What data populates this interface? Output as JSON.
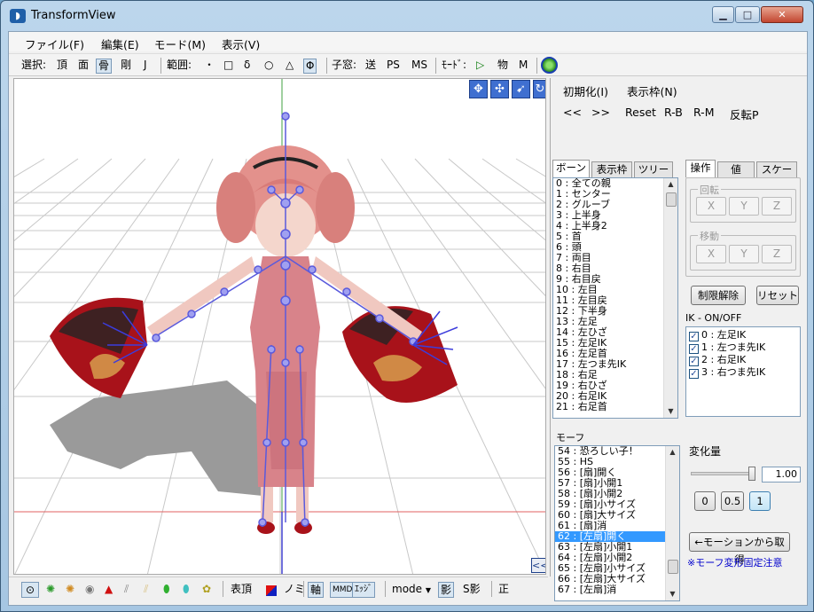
{
  "window": {
    "title": "TransformView",
    "min": "▁",
    "max": "□",
    "close": "✕"
  },
  "menu": [
    "ファイル(F)",
    "編集(E)",
    "モード(M)",
    "表示(V)"
  ],
  "toolbar": {
    "select_label": "選択:",
    "select_items": [
      "頂",
      "面",
      "骨",
      "剛",
      "J"
    ],
    "range_label": "範囲:",
    "range_items": [
      "・",
      "□",
      "δ",
      "○",
      "△",
      "Φ"
    ],
    "child_label": "子窓:",
    "child_items": [
      "送",
      "PS",
      "MS"
    ],
    "mode_label": "ﾓｰﾄﾞ:",
    "mode_items": [
      "▷",
      "物",
      "M"
    ]
  },
  "viewport": {
    "nav_icons": [
      "move-view-icon",
      "move-all-icon",
      "scale-icon",
      "rotate-icon"
    ],
    "collapse": "<<"
  },
  "bottom": {
    "mode_label": "表頂",
    "nomi": "ノミ",
    "axis": "軸",
    "mmd": "MMD",
    "edge": "ｴｯｼﾞ",
    "mode_select": "mode",
    "shadow": "影",
    "sshadow": "S影",
    "sei": "正",
    "accent_red": "#e01010",
    "accent_blue": "#1020c0"
  },
  "panel": {
    "init": "初期化(I)",
    "display_frame": "表示枠(N)",
    "prev": "<<",
    "next": ">>",
    "reset": "Reset",
    "rb": "R-B",
    "rm": "R-M",
    "flip": "反転P",
    "bone_tabs": [
      "ボーン",
      "表示枠",
      "ツリー"
    ],
    "bones": [
      "0 : 全ての親",
      "1 : センター",
      "2 : グルーブ",
      "3 : 上半身",
      "4 : 上半身2",
      "5 : 首",
      "6 : 頭",
      "7 : 両目",
      "8 : 右目",
      "9 : 右目戻",
      "10 : 左目",
      "11 : 左目戻",
      "12 : 下半身",
      "13 : 左足",
      "14 : 左ひざ",
      "15 : 左足IK",
      "16 : 左足首",
      "17 : 左つま先IK",
      "18 : 右足",
      "19 : 右ひざ",
      "20 : 右足IK",
      "21 : 右足首"
    ],
    "op_tabs": [
      "操作",
      "値",
      "スケール"
    ],
    "rotate_label": "回転",
    "move_label": "移動",
    "xyz": [
      "X",
      "Y",
      "Z"
    ],
    "unlock": "制限解除",
    "reset_btn": "リセット",
    "ik_title": "IK - ON/OFF",
    "ik_items": [
      "0 : 左足IK",
      "1 : 左つま先IK",
      "2 : 右足IK",
      "3 : 右つま先IK"
    ],
    "morph_title": "モーフ",
    "morphs": [
      "54 : 恐ろしい子！",
      "55 : HS",
      "56 : [扇]開く",
      "57 : [扇]小開1",
      "58 : [扇]小開2",
      "59 : [扇]小サイズ",
      "60 : [扇]大サイズ",
      "61 : [扇]消",
      "62 : [左扇]開く",
      "63 : [左扇]小開1",
      "64 : [左扇]小開2",
      "65 : [左扇]小サイズ",
      "66 : [左扇]大サイズ",
      "67 : [左扇]消"
    ],
    "morph_selected": 8,
    "change_title": "変化量",
    "change_value": "1.00",
    "slider_level": 1.0,
    "presets": [
      "0",
      "0.5",
      "1"
    ],
    "from_motion": "←モーションから取得",
    "notice": "※モーフ変形固定注意",
    "notice_color": "#0000cc"
  }
}
